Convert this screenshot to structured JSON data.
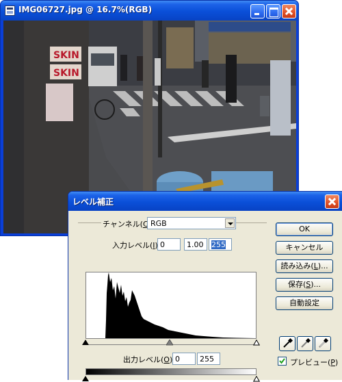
{
  "image_window": {
    "title": "IMG06727.jpg @ 16.7%(RGB)",
    "controls": [
      "minimize-icon",
      "maximize-icon",
      "close-icon"
    ],
    "colors": {
      "titlebar": "#0a4fd8"
    }
  },
  "levels_dialog": {
    "title": "レベル補正",
    "channel": {
      "label": "チャンネル(",
      "mnemonic": "C",
      "suffix": "):",
      "value": "RGB"
    },
    "input_levels": {
      "label": "入力レベル(",
      "mnemonic": "I",
      "suffix": "):",
      "black": "0",
      "gamma": "1.00",
      "white": "255"
    },
    "output_levels": {
      "label": "出力レベル(",
      "mnemonic": "O",
      "suffix": "):",
      "black": "0",
      "white": "255"
    },
    "buttons": {
      "ok": "OK",
      "cancel": "キャンセル",
      "load": {
        "pre": "読み込み(",
        "mnemonic": "L",
        "post": ")..."
      },
      "save": {
        "pre": "保存(",
        "mnemonic": "S",
        "post": ")..."
      },
      "auto": "自動設定"
    },
    "eyedroppers": [
      "black-eyedropper-icon",
      "gray-eyedropper-icon",
      "white-eyedropper-icon"
    ],
    "preview": {
      "pre": "プレビュー(",
      "mnemonic": "P",
      "post": ")",
      "checked": true
    }
  }
}
